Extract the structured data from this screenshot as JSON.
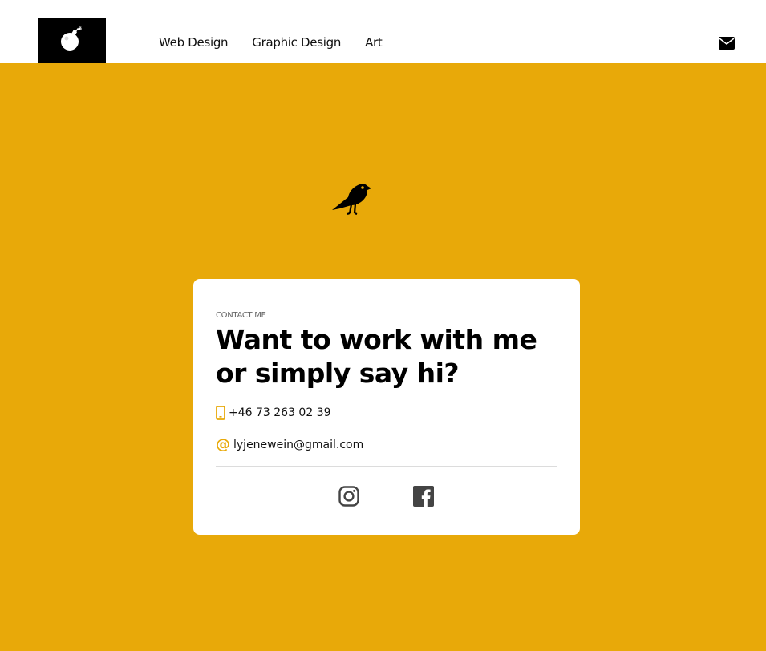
{
  "header": {
    "logo": {
      "icon": "bomb-icon"
    },
    "nav": [
      {
        "label": "Web Design"
      },
      {
        "label": "Graphic Design"
      },
      {
        "label": "Art"
      }
    ],
    "mail_icon": "envelope-icon"
  },
  "hero": {
    "icon": "crow-icon"
  },
  "contact": {
    "eyebrow": "CONTACT ME",
    "title": "Want to work with me or simply say hi?",
    "phone": "+46 73 263 02 39",
    "email": "lyjenewein@gmail.com",
    "social": [
      {
        "icon": "instagram-icon"
      },
      {
        "icon": "facebook-icon"
      }
    ]
  },
  "colors": {
    "accent": "#e8a909",
    "card": "#ffffff",
    "text": "#000000",
    "icon_gray": "#444444"
  }
}
